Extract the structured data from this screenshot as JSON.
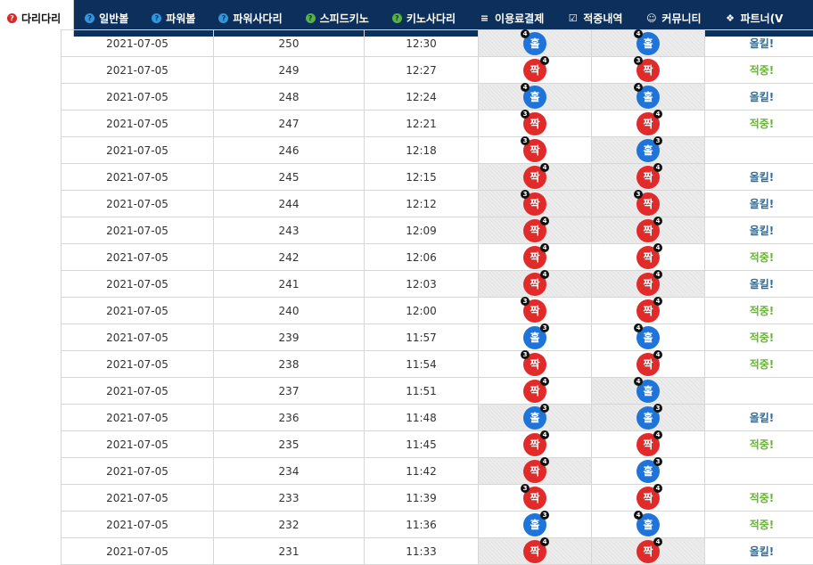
{
  "colors": {
    "nav_bg": "#0d2f5c",
    "odd_ball": "#1e74d8",
    "even_ball": "#e12a2a",
    "result_hit": "#6bb23a",
    "result_all": "#2f6f9a"
  },
  "nav": {
    "items": [
      {
        "label": "다리다리",
        "icon": "question-circle-icon",
        "active": true
      },
      {
        "label": "일반볼",
        "icon": "question-circle-icon",
        "active": false
      },
      {
        "label": "파워볼",
        "icon": "question-circle-icon",
        "active": false
      },
      {
        "label": "파워사다리",
        "icon": "question-circle-icon",
        "active": false
      },
      {
        "label": "스피드키노",
        "icon": "question-circle-icon",
        "active": false
      },
      {
        "label": "키노사다리",
        "icon": "question-circle-icon",
        "active": false
      },
      {
        "label": "이용료결제",
        "icon": "database-icon",
        "active": false
      },
      {
        "label": "적중내역",
        "icon": "checkbox-icon",
        "active": false
      },
      {
        "label": "커뮤니티",
        "icon": "smiley-icon",
        "active": false
      },
      {
        "label": "파트너(V",
        "icon": "cubes-icon",
        "active": false
      }
    ]
  },
  "table": {
    "rows": [
      {
        "date": "2021-07-05",
        "round": "250",
        "time": "12:30",
        "p1": {
          "text": "홀",
          "color": "blue",
          "badge": "4",
          "pos": "left"
        },
        "p2": {
          "text": "홀",
          "color": "blue",
          "badge": "4",
          "pos": "left"
        },
        "result": "올킬!",
        "rclass": "all",
        "g1": true,
        "g2": true
      },
      {
        "date": "2021-07-05",
        "round": "249",
        "time": "12:27",
        "p1": {
          "text": "짝",
          "color": "red",
          "badge": "4",
          "pos": "right"
        },
        "p2": {
          "text": "짝",
          "color": "red",
          "badge": "3",
          "pos": "left"
        },
        "result": "적중!",
        "rclass": "win",
        "g1": false,
        "g2": false
      },
      {
        "date": "2021-07-05",
        "round": "248",
        "time": "12:24",
        "p1": {
          "text": "홀",
          "color": "blue",
          "badge": "4",
          "pos": "left"
        },
        "p2": {
          "text": "홀",
          "color": "blue",
          "badge": "4",
          "pos": "left"
        },
        "result": "올킬!",
        "rclass": "all",
        "g1": true,
        "g2": true
      },
      {
        "date": "2021-07-05",
        "round": "247",
        "time": "12:21",
        "p1": {
          "text": "짝",
          "color": "red",
          "badge": "3",
          "pos": "left"
        },
        "p2": {
          "text": "짝",
          "color": "red",
          "badge": "4",
          "pos": "right"
        },
        "result": "적중!",
        "rclass": "win",
        "g1": false,
        "g2": false
      },
      {
        "date": "2021-07-05",
        "round": "246",
        "time": "12:18",
        "p1": {
          "text": "짝",
          "color": "red",
          "badge": "3",
          "pos": "left"
        },
        "p2": {
          "text": "홀",
          "color": "blue",
          "badge": "3",
          "pos": "right"
        },
        "result": "",
        "rclass": "",
        "g1": false,
        "g2": true
      },
      {
        "date": "2021-07-05",
        "round": "245",
        "time": "12:15",
        "p1": {
          "text": "짝",
          "color": "red",
          "badge": "4",
          "pos": "right"
        },
        "p2": {
          "text": "짝",
          "color": "red",
          "badge": "4",
          "pos": "right"
        },
        "result": "올킬!",
        "rclass": "all",
        "g1": true,
        "g2": true
      },
      {
        "date": "2021-07-05",
        "round": "244",
        "time": "12:12",
        "p1": {
          "text": "짝",
          "color": "red",
          "badge": "3",
          "pos": "left"
        },
        "p2": {
          "text": "짝",
          "color": "red",
          "badge": "3",
          "pos": "left"
        },
        "result": "올킬!",
        "rclass": "all",
        "g1": true,
        "g2": true
      },
      {
        "date": "2021-07-05",
        "round": "243",
        "time": "12:09",
        "p1": {
          "text": "짝",
          "color": "red",
          "badge": "4",
          "pos": "right"
        },
        "p2": {
          "text": "짝",
          "color": "red",
          "badge": "4",
          "pos": "right"
        },
        "result": "올킬!",
        "rclass": "all",
        "g1": true,
        "g2": true
      },
      {
        "date": "2021-07-05",
        "round": "242",
        "time": "12:06",
        "p1": {
          "text": "짝",
          "color": "red",
          "badge": "4",
          "pos": "right"
        },
        "p2": {
          "text": "짝",
          "color": "red",
          "badge": "4",
          "pos": "right"
        },
        "result": "적중!",
        "rclass": "win",
        "g1": false,
        "g2": false
      },
      {
        "date": "2021-07-05",
        "round": "241",
        "time": "12:03",
        "p1": {
          "text": "짝",
          "color": "red",
          "badge": "4",
          "pos": "right"
        },
        "p2": {
          "text": "짝",
          "color": "red",
          "badge": "4",
          "pos": "right"
        },
        "result": "올킬!",
        "rclass": "all",
        "g1": true,
        "g2": true
      },
      {
        "date": "2021-07-05",
        "round": "240",
        "time": "12:00",
        "p1": {
          "text": "짝",
          "color": "red",
          "badge": "3",
          "pos": "left"
        },
        "p2": {
          "text": "짝",
          "color": "red",
          "badge": "4",
          "pos": "right"
        },
        "result": "적중!",
        "rclass": "win",
        "g1": false,
        "g2": false
      },
      {
        "date": "2021-07-05",
        "round": "239",
        "time": "11:57",
        "p1": {
          "text": "홀",
          "color": "blue",
          "badge": "3",
          "pos": "right"
        },
        "p2": {
          "text": "홀",
          "color": "blue",
          "badge": "4",
          "pos": "left"
        },
        "result": "적중!",
        "rclass": "win",
        "g1": false,
        "g2": false
      },
      {
        "date": "2021-07-05",
        "round": "238",
        "time": "11:54",
        "p1": {
          "text": "짝",
          "color": "red",
          "badge": "3",
          "pos": "left"
        },
        "p2": {
          "text": "짝",
          "color": "red",
          "badge": "4",
          "pos": "right"
        },
        "result": "적중!",
        "rclass": "win",
        "g1": false,
        "g2": false
      },
      {
        "date": "2021-07-05",
        "round": "237",
        "time": "11:51",
        "p1": {
          "text": "짝",
          "color": "red",
          "badge": "4",
          "pos": "right"
        },
        "p2": {
          "text": "홀",
          "color": "blue",
          "badge": "4",
          "pos": "left"
        },
        "result": "",
        "rclass": "",
        "g1": false,
        "g2": true
      },
      {
        "date": "2021-07-05",
        "round": "236",
        "time": "11:48",
        "p1": {
          "text": "홀",
          "color": "blue",
          "badge": "3",
          "pos": "right"
        },
        "p2": {
          "text": "홀",
          "color": "blue",
          "badge": "3",
          "pos": "right"
        },
        "result": "올킬!",
        "rclass": "all",
        "g1": true,
        "g2": true
      },
      {
        "date": "2021-07-05",
        "round": "235",
        "time": "11:45",
        "p1": {
          "text": "짝",
          "color": "red",
          "badge": "4",
          "pos": "right"
        },
        "p2": {
          "text": "짝",
          "color": "red",
          "badge": "4",
          "pos": "right"
        },
        "result": "적중!",
        "rclass": "win",
        "g1": false,
        "g2": false
      },
      {
        "date": "2021-07-05",
        "round": "234",
        "time": "11:42",
        "p1": {
          "text": "짝",
          "color": "red",
          "badge": "4",
          "pos": "right"
        },
        "p2": {
          "text": "홀",
          "color": "blue",
          "badge": "3",
          "pos": "right"
        },
        "result": "",
        "rclass": "",
        "g1": true,
        "g2": false
      },
      {
        "date": "2021-07-05",
        "round": "233",
        "time": "11:39",
        "p1": {
          "text": "짝",
          "color": "red",
          "badge": "3",
          "pos": "left"
        },
        "p2": {
          "text": "짝",
          "color": "red",
          "badge": "4",
          "pos": "right"
        },
        "result": "적중!",
        "rclass": "win",
        "g1": false,
        "g2": false
      },
      {
        "date": "2021-07-05",
        "round": "232",
        "time": "11:36",
        "p1": {
          "text": "홀",
          "color": "blue",
          "badge": "3",
          "pos": "right"
        },
        "p2": {
          "text": "홀",
          "color": "blue",
          "badge": "4",
          "pos": "left"
        },
        "result": "적중!",
        "rclass": "win",
        "g1": false,
        "g2": false
      },
      {
        "date": "2021-07-05",
        "round": "231",
        "time": "11:33",
        "p1": {
          "text": "짝",
          "color": "red",
          "badge": "4",
          "pos": "right"
        },
        "p2": {
          "text": "짝",
          "color": "red",
          "badge": "4",
          "pos": "right"
        },
        "result": "올킬!",
        "rclass": "all",
        "g1": true,
        "g2": true
      }
    ]
  }
}
